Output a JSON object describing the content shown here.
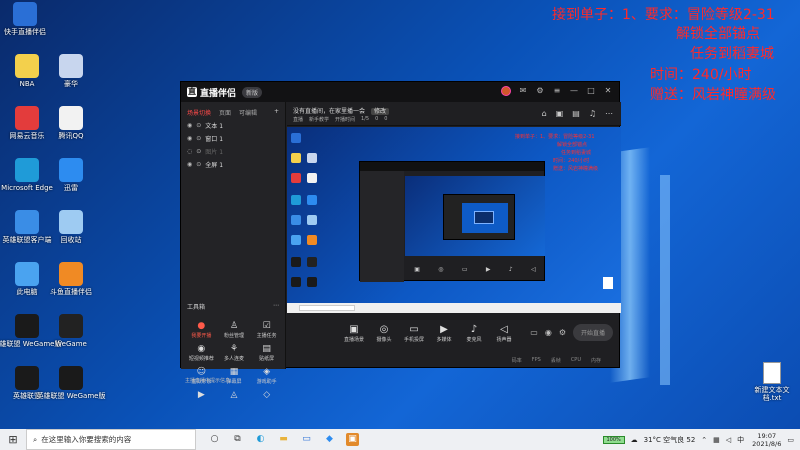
{
  "desktop": {
    "icons_left": [
      {
        "label": "快手直播伴侣",
        "icon": "kuaishou-live-icon",
        "color": "#2a6fd6"
      },
      {
        "label": "NBA",
        "icon": "nba-icon",
        "color": "#f3d04c"
      },
      {
        "label": "豪华",
        "icon": "game-avatar-icon",
        "color": "#c8d6ee"
      },
      {
        "label": "网易云音乐",
        "icon": "netease-music-icon",
        "color": "#e33c3c"
      },
      {
        "label": "腾讯QQ",
        "icon": "qq-icon",
        "color": "#f2f2f2"
      },
      {
        "label": "Microsoft Edge",
        "icon": "edge-icon",
        "color": "#1f9bd8"
      },
      {
        "label": "迅雷",
        "icon": "xunlei-icon",
        "color": "#2d8cf0"
      },
      {
        "label": "英雄联盟客户端",
        "icon": "lol-client-icon",
        "color": "#3a8de6"
      },
      {
        "label": "回收站",
        "icon": "recycle-bin-icon",
        "color": "#9ecbf2"
      },
      {
        "label": "此电脑",
        "icon": "this-pc-icon",
        "color": "#4aa3f0"
      },
      {
        "label": "斗鱼直播伴侣",
        "icon": "douyu-icon",
        "color": "#f08a24"
      },
      {
        "label": "英雄联盟 WeGame版",
        "icon": "lol-wegame-icon",
        "color": "#1a1a1a"
      },
      {
        "label": "WeGame",
        "icon": "wegame-icon",
        "color": "#222"
      },
      {
        "label": "英雄联盟",
        "icon": "lol-icon",
        "color": "#1a1a1a"
      },
      {
        "label": "英雄联盟 WeGame版",
        "icon": "lol-wegame-icon-2",
        "color": "#1a1a1a"
      }
    ],
    "red_overlay": [
      "接到单子：1、要求：冒险等级2-31",
      "解锁全部锚点",
      "任务到稻妻城",
      "时间：240/小时",
      "赠送：风岩神瞳满级"
    ],
    "right_file": "新建文本文档.txt"
  },
  "app": {
    "name": "直播伴侣",
    "badge": "新版",
    "tabs": [
      "场景切换",
      "页面",
      "可编辑"
    ],
    "scenes": [
      "文本 1",
      "窗口 1",
      "图片 1",
      "全屏 1"
    ],
    "toolbox_title": "工具箱",
    "tools": [
      {
        "label": "我要开播",
        "icon": "●",
        "hot": true
      },
      {
        "label": "粉丝管理",
        "icon": "♙",
        "hot": false
      },
      {
        "label": "主播任务",
        "icon": "☑",
        "hot": false
      },
      {
        "label": "短视频推荐",
        "icon": "◉",
        "hot": false
      },
      {
        "label": "多人连麦",
        "icon": "⚘",
        "hot": false
      },
      {
        "label": "贴纸屏",
        "icon": "▤",
        "hot": false
      },
      {
        "label": "虚拟形象",
        "icon": "☺",
        "hot": false
      },
      {
        "label": "弹幕屏",
        "icon": "▦",
        "hot": false
      },
      {
        "label": "游戏助手",
        "icon": "◈",
        "hot": false
      },
      {
        "label": "",
        "icon": "▶",
        "hot": false
      },
      {
        "label": "",
        "icon": "◬",
        "hot": false
      },
      {
        "label": "",
        "icon": "◇",
        "hot": false
      }
    ],
    "bottom_tip": "主播直播中提示信息",
    "topbar_line1": "没有直播间，在家里播一会",
    "topbar_btn": "修改",
    "topbar_line2": [
      "直播",
      "新手教学",
      "开播时间",
      "1/5",
      "0",
      "0"
    ],
    "controls": [
      {
        "label": "直播场景",
        "icon": "▣"
      },
      {
        "label": "摄像头",
        "icon": "◎"
      },
      {
        "label": "手机投屏",
        "icon": "▭"
      },
      {
        "label": "多媒体",
        "icon": "▶"
      },
      {
        "label": "麦克风",
        "icon": "♪"
      },
      {
        "label": "扬声器",
        "icon": "◁"
      }
    ],
    "live_button": "开始直播",
    "status_items": [
      "码率",
      "FPS",
      "丢帧",
      "CPU",
      "内存"
    ]
  },
  "taskbar": {
    "search_placeholder": "在这里输入你要搜索的内容",
    "weather": "31°C 空气良 52",
    "time": "19:07",
    "date": "2021/8/6",
    "battery": "100%"
  }
}
